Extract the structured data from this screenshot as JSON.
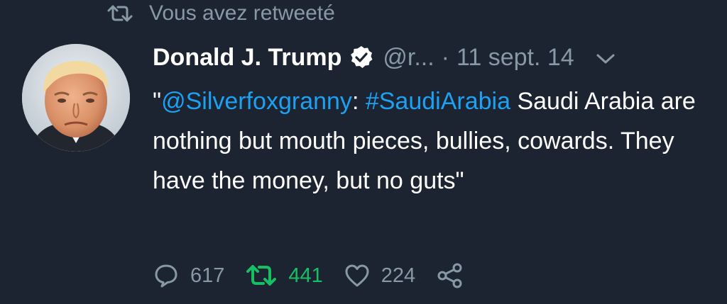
{
  "retweet_context": {
    "text": "Vous avez retweeté",
    "icon": "retweet-icon"
  },
  "tweet": {
    "display_name": "Donald J. Trump",
    "verified": true,
    "handle": "@r...",
    "separator": "·",
    "date": "11 sept. 14",
    "text_segments": {
      "open_quote": "\"",
      "mention": "@Silverfoxgranny",
      "colon": ": ",
      "hashtag": "#SaudiArabia",
      "body": " Saudi Arabia are nothing but mouth pieces, bullies, cowards. They have the money, but no guts\""
    },
    "actions": {
      "reply_count": "617",
      "retweet_count": "441",
      "like_count": "224"
    }
  },
  "colors": {
    "background": "#1c2331",
    "secondary_text": "#8899a6",
    "link": "#1da1f2",
    "retweeted_green": "#17bf63",
    "primary_text": "#ffffff"
  },
  "icons": [
    "retweet-icon",
    "verified-badge-icon",
    "chevron-down-icon",
    "reply-icon",
    "like-icon",
    "share-icon"
  ]
}
